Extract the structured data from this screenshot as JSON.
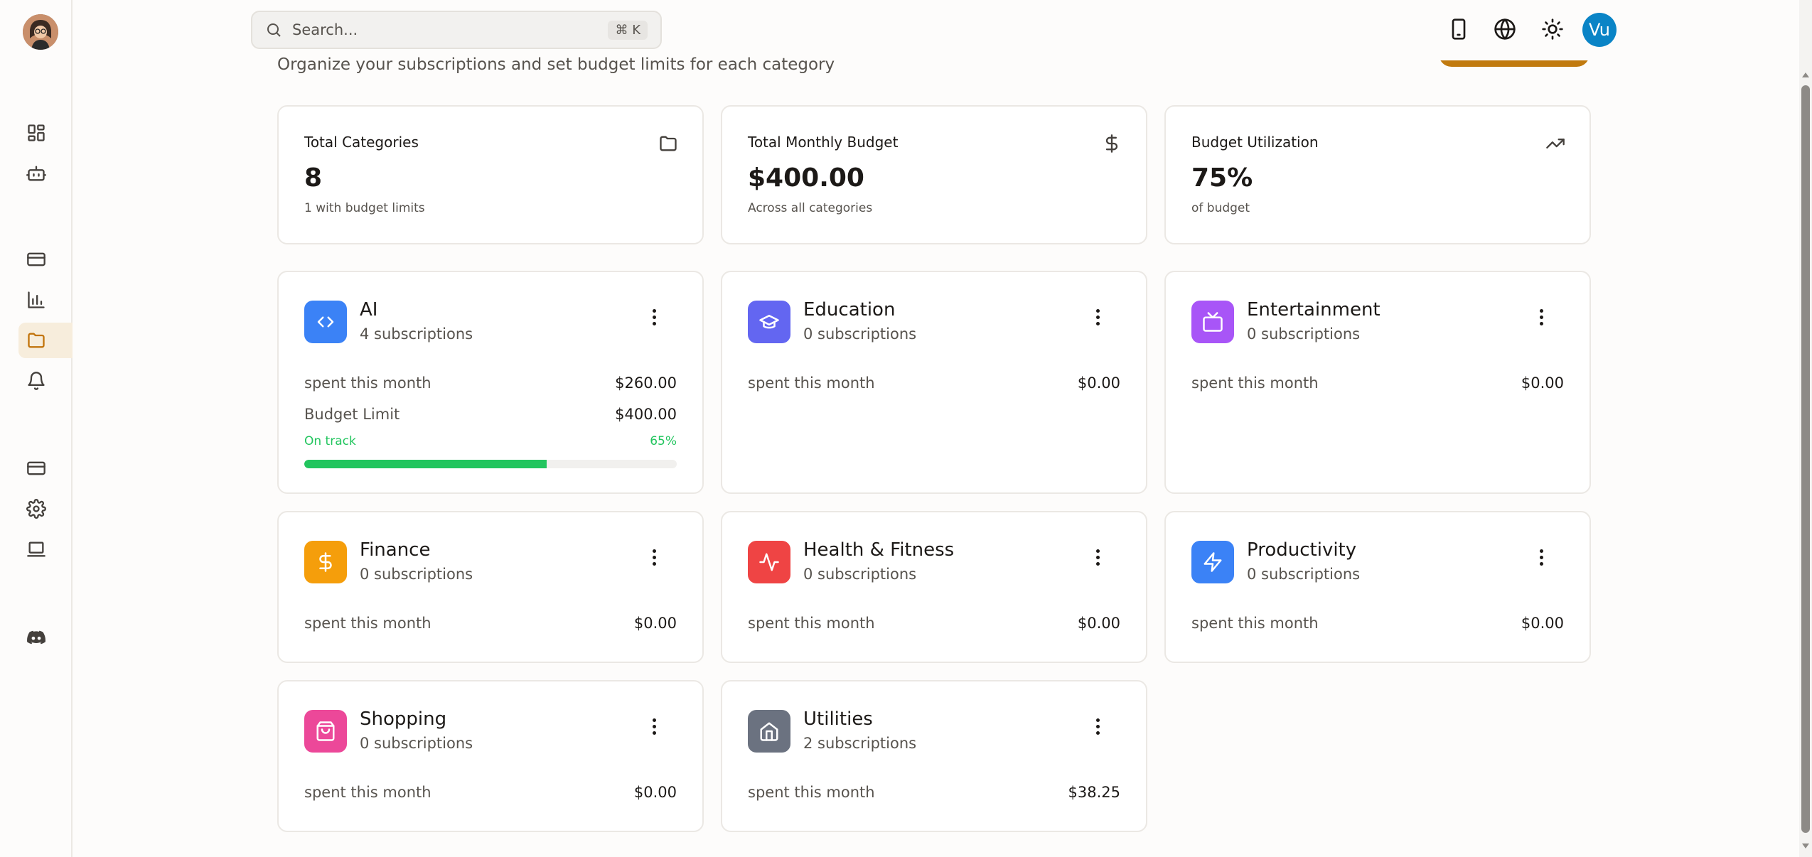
{
  "search": {
    "placeholder": "Search...",
    "shortcut": "⌘ K"
  },
  "header": {
    "subtitle": "Organize your subscriptions and set budget limits for each category",
    "user_initials": "Vu"
  },
  "stats": [
    {
      "label": "Total Categories",
      "value": "8",
      "sub": "1 with budget limits",
      "icon": "folder-icon"
    },
    {
      "label": "Total Monthly Budget",
      "value": "$400.00",
      "sub": "Across all categories",
      "icon": "dollar-icon"
    },
    {
      "label": "Budget Utilization",
      "value": "75%",
      "sub": "of budget",
      "icon": "trending-up-icon"
    }
  ],
  "categories": [
    {
      "name": "AI",
      "count": "4 subscriptions",
      "spent_label": "spent this month",
      "spent": "$260.00",
      "limit_label": "Budget Limit",
      "limit": "$400.00",
      "status": "On track",
      "percent_label": "65%",
      "percent": 65,
      "color": "#3b82f6",
      "icon": "code-icon"
    },
    {
      "name": "Education",
      "count": "0 subscriptions",
      "spent_label": "spent this month",
      "spent": "$0.00",
      "color": "#6366f1",
      "icon": "graduation-cap-icon"
    },
    {
      "name": "Entertainment",
      "count": "0 subscriptions",
      "spent_label": "spent this month",
      "spent": "$0.00",
      "color": "#a855f7",
      "icon": "tv-icon"
    },
    {
      "name": "Finance",
      "count": "0 subscriptions",
      "spent_label": "spent this month",
      "spent": "$0.00",
      "color": "#f59e0b",
      "icon": "dollar-icon"
    },
    {
      "name": "Health & Fitness",
      "count": "0 subscriptions",
      "spent_label": "spent this month",
      "spent": "$0.00",
      "color": "#ef4444",
      "icon": "activity-icon"
    },
    {
      "name": "Productivity",
      "count": "0 subscriptions",
      "spent_label": "spent this month",
      "spent": "$0.00",
      "color": "#3b82f6",
      "icon": "zap-icon"
    },
    {
      "name": "Shopping",
      "count": "0 subscriptions",
      "spent_label": "spent this month",
      "spent": "$0.00",
      "color": "#ec4899",
      "icon": "shopping-bag-icon"
    },
    {
      "name": "Utilities",
      "count": "2 subscriptions",
      "spent_label": "spent this month",
      "spent": "$38.25",
      "color": "#6b7280",
      "icon": "home-icon"
    }
  ]
}
